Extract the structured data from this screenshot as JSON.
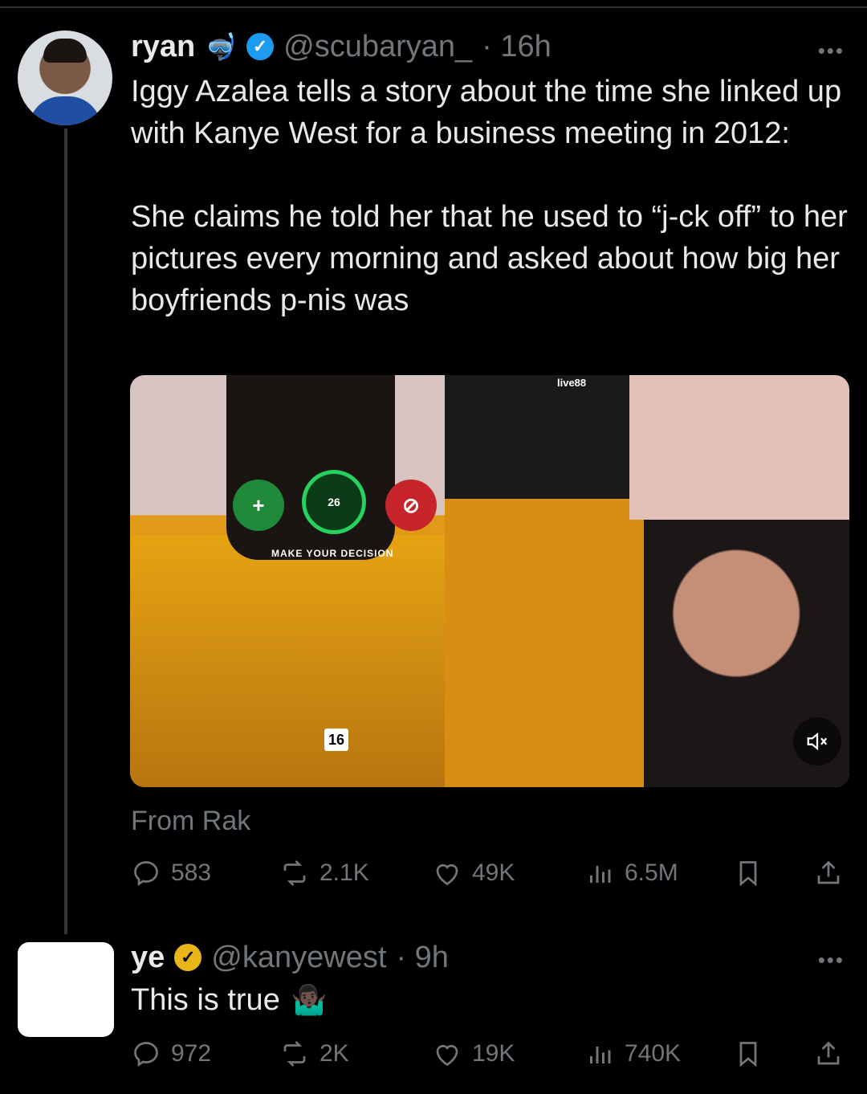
{
  "tweet1": {
    "name": "ryan",
    "name_emoji": "🤿",
    "handle": "@scubaryan_",
    "time": "· 16h",
    "more": "•••",
    "paragraphs": [
      "Iggy Azalea tells a story about the time she linked up with Kanye West for a business meeting in 2012:",
      "She claims he told her that he used to “j-ck off” to her pictures every morning and asked about how big her boyfriends p-nis was"
    ],
    "media": {
      "timer": "26",
      "decision_label": "MAKE YOUR DECISION",
      "brand": "live88",
      "card_value": "16",
      "mute_icon": "muted-speaker-icon"
    },
    "from_label": "From Rak",
    "stats": {
      "replies": "583",
      "reposts": "2.1K",
      "likes": "49K",
      "views": "6.5M"
    }
  },
  "tweet2": {
    "name": "ye",
    "handle": "@kanyewest",
    "time": "· 9h",
    "more": "•••",
    "text": "This is true",
    "emoji": "🤷🏿‍♂️",
    "stats": {
      "replies": "972",
      "reposts": "2K",
      "likes": "19K",
      "views": "740K"
    }
  },
  "colors": {
    "background": "#000000",
    "text": "#e7e9ea",
    "muted": "#71767b",
    "verified_blue": "#1d9bf0",
    "verified_gold": "#e8b619"
  }
}
